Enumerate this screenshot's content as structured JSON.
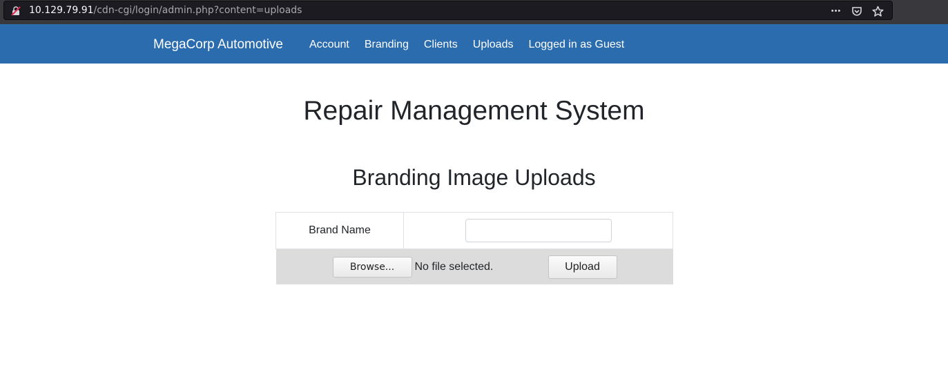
{
  "browser": {
    "url_host": "10.129.79.91",
    "url_path": "/cdn-cgi/login/admin.php?content=uploads",
    "icons": [
      "insecure-lock-icon",
      "more-actions-icon",
      "pocket-icon",
      "bookmark-star-icon"
    ],
    "more_glyph": "•••"
  },
  "navbar": {
    "brand": "MegaCorp Automotive",
    "items": [
      {
        "label": "Account"
      },
      {
        "label": "Branding"
      },
      {
        "label": "Clients"
      },
      {
        "label": "Uploads"
      },
      {
        "label": "Logged in as Guest"
      }
    ],
    "color": "#2b6cae"
  },
  "page": {
    "title": "Repair Management System",
    "subtitle": "Branding Image Uploads"
  },
  "form": {
    "brand_name_label": "Brand Name",
    "brand_name_value": "",
    "browse_label": "Browse...",
    "file_status": "No file selected.",
    "upload_label": "Upload"
  }
}
